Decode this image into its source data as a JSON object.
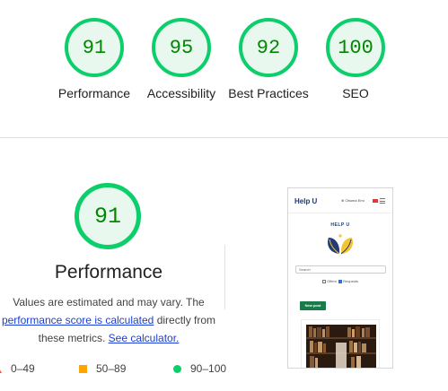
{
  "colors": {
    "pass_green": "#0cce6b",
    "pass_text": "#008800",
    "average_orange": "#ffa400",
    "fail_red": "#ff4e42",
    "link_blue": "#1a3ed6"
  },
  "summary": [
    {
      "score": "91",
      "label": "Performance"
    },
    {
      "score": "95",
      "label": "Accessibility"
    },
    {
      "score": "92",
      "label": "Best Practices"
    },
    {
      "score": "100",
      "label": "SEO"
    }
  ],
  "performance": {
    "score": "91",
    "title": "Performance",
    "desc_before": "Values are estimated and may vary. The ",
    "link_score": "performance score is calculated",
    "desc_middle": " directly from these metrics. ",
    "link_calculator": "See calculator."
  },
  "legend": [
    {
      "icon": "triangle-icon",
      "range": "0–49"
    },
    {
      "icon": "square-icon",
      "range": "50–89"
    },
    {
      "icon": "circle-icon",
      "range": "90–100"
    }
  ],
  "thumbnail": {
    "brand": "Help U",
    "user": "⊕ Obuma Emi",
    "page_title": "HELP U",
    "search_placeholder": "Search",
    "filter_offers": "Offers",
    "filter_requests": "Requests",
    "new_post": "New post"
  }
}
